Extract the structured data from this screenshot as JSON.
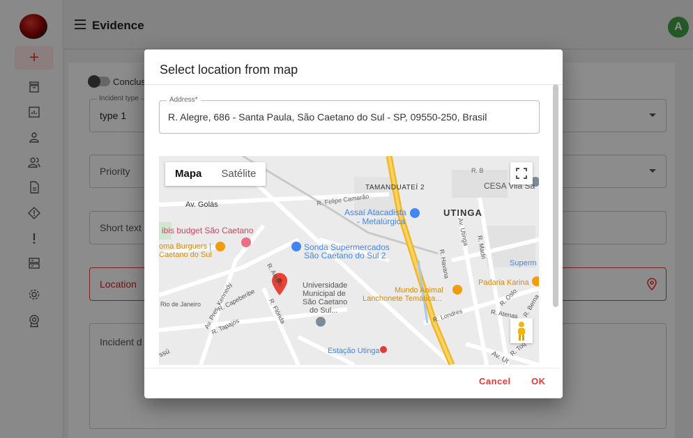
{
  "app": {
    "title": "Evidence",
    "avatar_initial": "A",
    "accent": "#e53935",
    "avatar_color": "#43a047"
  },
  "sidebar": {
    "items": [
      {
        "icon": "plus-icon"
      },
      {
        "icon": "inbox-icon"
      },
      {
        "icon": "report-icon"
      },
      {
        "icon": "person-icon"
      },
      {
        "icon": "people-icon"
      },
      {
        "icon": "document-icon"
      },
      {
        "icon": "warning-diamond-icon"
      },
      {
        "icon": "exclamation-icon"
      },
      {
        "icon": "server-icon"
      },
      {
        "icon": "gear-icon"
      },
      {
        "icon": "badge-icon"
      }
    ]
  },
  "form": {
    "toggle_label": "Conclus",
    "incident_type": {
      "legend": "Incident type",
      "value": "type 1"
    },
    "priority": {
      "placeholder": "Priority"
    },
    "short_text": {
      "placeholder": "Short text"
    },
    "location": {
      "placeholder": "Location"
    },
    "incident_description": {
      "placeholder": "Incident d"
    }
  },
  "dialog": {
    "title": "Select location from map",
    "address": {
      "legend": "Address*",
      "value": "R. Alegre, 686 - Santa Paula, São Caetano do Sul - SP, 09550-250, Brasil"
    },
    "map": {
      "tabs": [
        "Mapa",
        "Satélite"
      ],
      "active_tab": "Mapa",
      "labels": {
        "tamanduatei": "TAMANDUATEÍ 2",
        "cesa": "CESA Vila Sa",
        "rb": "R. B",
        "felipe": "R. Felipe Camarão",
        "assai1": "Assaí Atacadista",
        "assai2": "- Metalúrgica",
        "utinga": "UTINGA",
        "golas": "Av. Golás",
        "ibis": "ibis budget São Caetano",
        "burguers1": "oma Burguers |",
        "burguers2": "Caetano do Sul",
        "sonda1": "Sonda Supermercados",
        "sonda2": "São Caetano do Sul 2",
        "superm": "Superm",
        "padaria": "Padaria Karina",
        "mundo1": "Mundo Animal",
        "mundo2": "Lanchonete Temática...",
        "univ1": "Universidade",
        "univ2": "Municipal de",
        "univ3": "São Caetano",
        "univ4": "do Sul...",
        "rio": "Rio de Janeiro",
        "kennedy": "Av. Pres. Kennedy",
        "capeberibe": "R. Capeberibe",
        "tapajos": "R. Tapajós",
        "florida": "R. Flórida",
        "alegre": "R. Alegre",
        "estacao": "Estação Utinga",
        "havana": "R. Havana",
        "madri": "R. Madri",
        "utinga_st": "Av. Utinga",
        "londres": "R. Londres",
        "oslo": "R. Oslo",
        "atenas": "R. Atenas",
        "berna": "R. Berna",
        "toque": "R. Toq",
        "assu": "ssú",
        "avut": "Av. Ut"
      }
    },
    "cancel_label": "Cancel",
    "ok_label": "OK"
  }
}
